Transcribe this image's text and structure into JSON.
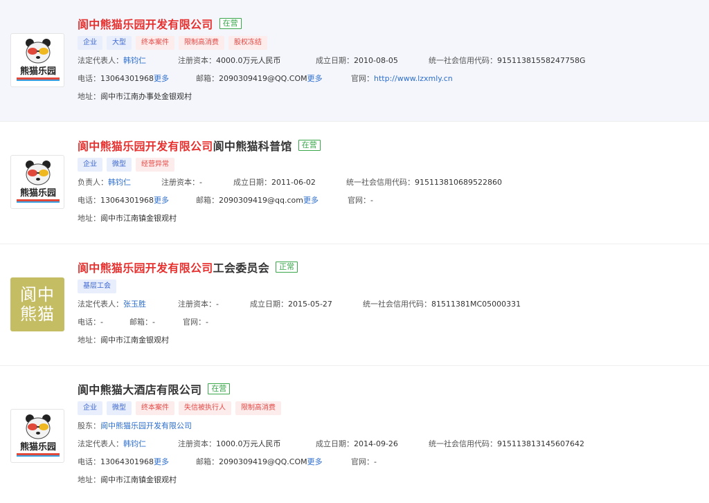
{
  "cards": [
    {
      "name_red": "阆中熊猫乐园开发有限公司",
      "name_dark": "",
      "status": "在营",
      "tags": [
        {
          "text": "企业",
          "kind": "blue"
        },
        {
          "text": "大型",
          "kind": "blue"
        },
        {
          "text": "终本案件",
          "kind": "red"
        },
        {
          "text": "限制高消费",
          "kind": "red"
        },
        {
          "text": "股权冻结",
          "kind": "red"
        }
      ],
      "rep_label": "法定代表人：",
      "rep": "韩钧仁",
      "capital_label": "注册资本：",
      "capital": "4000.0万元人民币",
      "date_label": "成立日期：",
      "date": "2010-08-05",
      "code_label": "统一社会信用代码：",
      "code": "91511381558247758G",
      "phone_label": "电话：",
      "phone": "13064301968",
      "email_label": "邮箱：",
      "email": "2090309419@QQ.COM",
      "web_label": "官网：",
      "web": "http://www.lzxmly.cn",
      "addr_label": "地址：",
      "addr": "阆中市江南办事处金银观村",
      "more": "更多"
    },
    {
      "name_red": "阆中熊猫乐园开发有限公司",
      "name_dark": "阆中熊猫科普馆",
      "status": "在营",
      "tags": [
        {
          "text": "企业",
          "kind": "blue"
        },
        {
          "text": "微型",
          "kind": "blue"
        },
        {
          "text": "经营异常",
          "kind": "red"
        }
      ],
      "rep_label": "负责人：",
      "rep": "韩钧仁",
      "capital_label": "注册资本：",
      "capital": "-",
      "date_label": "成立日期：",
      "date": "2011-06-02",
      "code_label": "统一社会信用代码：",
      "code": "91511381068952286​0",
      "phone_label": "电话：",
      "phone": "13064301968",
      "email_label": "邮箱：",
      "email": "2090309419@qq.com",
      "web_label": "官网：",
      "web": "-",
      "addr_label": "地址：",
      "addr": "阆中市江南镇金银观村",
      "more": "更多"
    },
    {
      "name_red": "阆中熊猫乐园开发有限公司",
      "name_dark": "工会委员会",
      "status": "正常",
      "tags": [
        {
          "text": "基层工会",
          "kind": "blue"
        }
      ],
      "rep_label": "法定代表人：",
      "rep": "张玉胜",
      "capital_label": "注册资本：",
      "capital": "-",
      "date_label": "成立日期：",
      "date": "2015-05-27",
      "code_label": "统一社会信用代码：",
      "code": "81511381MC05000331",
      "phone_label": "电话：",
      "phone": "-",
      "email_label": "邮箱：",
      "email": "-",
      "web_label": "官网：",
      "web": "-",
      "addr_label": "地址：",
      "addr": "阆中市江南金银观村",
      "logo_line1": "阆中",
      "logo_line2": "熊猫"
    },
    {
      "name_red": "",
      "name_dark": "阆中熊猫大酒店有限公司",
      "status": "在营",
      "tags": [
        {
          "text": "企业",
          "kind": "blue"
        },
        {
          "text": "微型",
          "kind": "blue"
        },
        {
          "text": "终本案件",
          "kind": "red"
        },
        {
          "text": "失信被执行人",
          "kind": "red"
        },
        {
          "text": "限制高消费",
          "kind": "red"
        }
      ],
      "holder_label": "股东：",
      "holder": "阆中熊猫乐园开发有限公司",
      "rep_label": "法定代表人：",
      "rep": "韩钧仁",
      "capital_label": "注册资本：",
      "capital": "1000.0万元人民币",
      "date_label": "成立日期：",
      "date": "2014-09-26",
      "code_label": "统一社会信用代码：",
      "code": "915113813145607642",
      "phone_label": "电话：",
      "phone": "13064301968",
      "email_label": "邮箱：",
      "email": "2090309419@QQ.COM",
      "web_label": "官网：",
      "web": "-",
      "addr_label": "地址：",
      "addr": "阆中市江南镇金银观村",
      "more": "更多"
    }
  ],
  "panda_logo_text": "熊猫乐园",
  "colors": {
    "accent_red": "#e5312f",
    "link_blue": "#2d6ecf",
    "status_green": "#39a64a",
    "logo_olive": "#c4bd63"
  }
}
